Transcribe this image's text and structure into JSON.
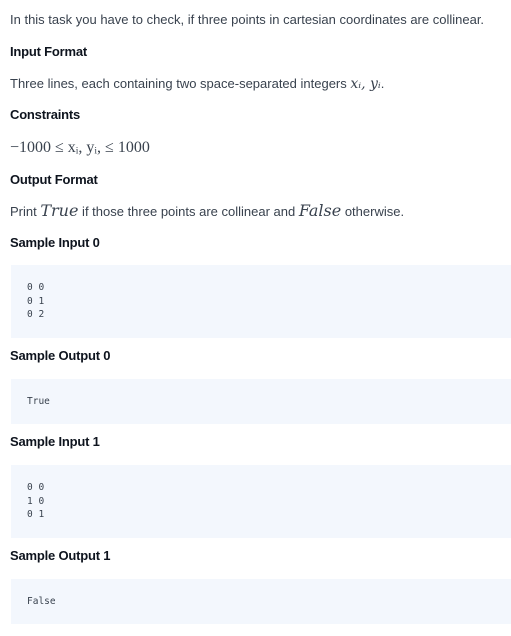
{
  "intro": "In this task you have to check, if three points in cartesian coordinates are collinear.",
  "input_format": {
    "heading": "Input Format",
    "text": "Three lines, each containing two space-separated integers ",
    "math": "xᵢ, yᵢ",
    "end": "."
  },
  "constraints": {
    "heading": "Constraints",
    "math": "−1000 ≤ xᵢ, yᵢ, ≤ 1000"
  },
  "output_format": {
    "heading": "Output Format",
    "pre": "Print ",
    "true_math": "True",
    "mid": " if those three points are collinear and ",
    "false_math": "False",
    "post": " otherwise."
  },
  "samples": [
    {
      "heading": "Sample Input 0",
      "code": "0 0\n0 1\n0 2"
    },
    {
      "heading": "Sample Output 0",
      "code": "True"
    },
    {
      "heading": "Sample Input 1",
      "code": "0 0\n1 0\n0 1"
    },
    {
      "heading": "Sample Output 1",
      "code": "False"
    }
  ],
  "colors": {
    "text": "#39424e",
    "heading": "#0e141e",
    "code_bg": "#f3f7fd"
  }
}
